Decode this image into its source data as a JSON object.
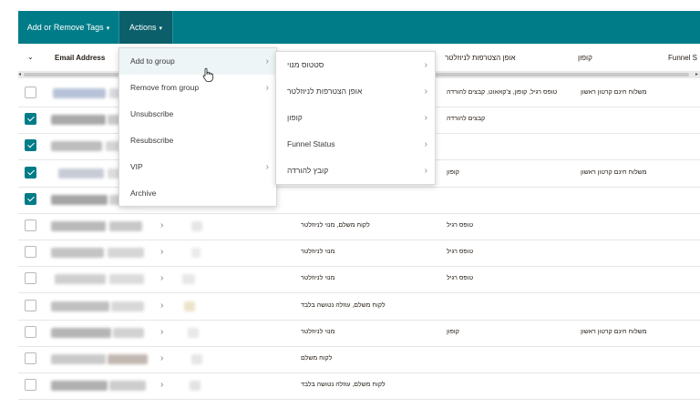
{
  "toolbar": {
    "tags_label": "Add or Remove Tags",
    "actions_label": "Actions",
    "caret": "▾"
  },
  "header": {
    "select_caret": "⌄",
    "email": "Email Address",
    "col_signup_method": "אופן הצטרפות לניוזלטר",
    "col_coupon": "קופון",
    "col_funnel": "Funnel S"
  },
  "menu": {
    "items": [
      {
        "label": "Add to group",
        "has_sub": true,
        "hover": true
      },
      {
        "label": "Remove from group",
        "has_sub": true
      },
      {
        "label": "Unsubscribe",
        "has_sub": false
      },
      {
        "label": "Resubscribe",
        "has_sub": false
      },
      {
        "label": "VIP",
        "has_sub": true
      },
      {
        "label": "Archive",
        "has_sub": false
      }
    ],
    "arrow": "›"
  },
  "submenu": {
    "items": [
      {
        "label": "סטטוס מנוי"
      },
      {
        "label": "אופן הצטרפות לניוזלטר"
      },
      {
        "label": "קופון"
      },
      {
        "label": "Funnel Status"
      },
      {
        "label": "קובץ להורדה"
      }
    ]
  },
  "rows": [
    {
      "checked": false,
      "chev": "",
      "a": "",
      "b": "טופס רגיל, קופון, צ'קאאוט, קבצים להורדה",
      "c": "משלוח חינם קרטון ראשון"
    },
    {
      "checked": true,
      "chev": "",
      "a": "",
      "b": "קבצים להורדה",
      "c": ""
    },
    {
      "checked": true,
      "chev": "",
      "a": "",
      "b": "",
      "c": ""
    },
    {
      "checked": true,
      "chev": "",
      "a": "",
      "b": "קופון",
      "c": "משלוח חינם קרטון ראשון"
    },
    {
      "checked": true,
      "chev": "",
      "a": "",
      "b": "",
      "c": ""
    },
    {
      "checked": false,
      "chev": "›",
      "a": "לקוח משלם, מנוי לניוזלטר",
      "b": "טופס רגיל",
      "c": ""
    },
    {
      "checked": false,
      "chev": "›",
      "a": "מנוי לניוזלטר",
      "b": "טופס רגיל",
      "c": ""
    },
    {
      "checked": false,
      "chev": "›",
      "a": "מנוי לניוזלטר",
      "b": "טופס רגיל",
      "c": ""
    },
    {
      "checked": false,
      "chev": "›",
      "a": "לקוח משלם, עוזלה נטושה בלבד",
      "b": "",
      "c": ""
    },
    {
      "checked": false,
      "chev": "›",
      "a": "מנוי לניוזלטר",
      "b": "קופון",
      "c": "משלוח חינם קרטון ראשון"
    },
    {
      "checked": false,
      "chev": "›",
      "a": "לקוח משלם",
      "b": "",
      "c": ""
    },
    {
      "checked": false,
      "chev": "›",
      "a": "לקוח משלם, עוזלה נטושה בלבד",
      "b": "",
      "c": ""
    }
  ],
  "colors": {
    "toolbar": "#007c89",
    "toolbar_active": "#0b5f6a",
    "checkbox_checked": "#007c89"
  },
  "icons": {
    "scroll_left": "◂",
    "scroll_right": "▸"
  }
}
